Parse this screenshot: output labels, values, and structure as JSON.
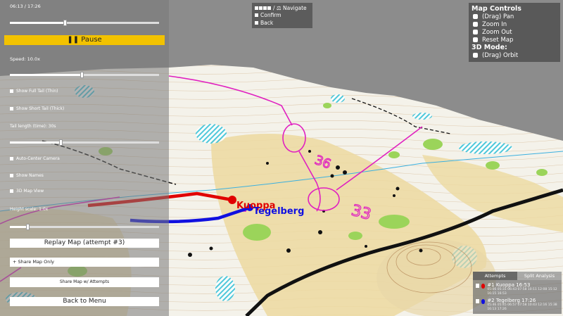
{
  "replay": {
    "time_display": "06:13 / 17:26",
    "progress": 0.37,
    "pause_label": "Pause",
    "speed_label": "Speed: 10.0x",
    "speed_fraction": 0.48
  },
  "options": {
    "show_full_tail": "Show Full Tail (Thin)",
    "show_short_tail": "Show Short Tail (Thick)",
    "tail_length_label": "Tail length (time): 30s",
    "tail_fraction": 0.34,
    "auto_center": "Auto-Center Camera",
    "show_names": "Show Names",
    "map_3d_view": "3D Map View",
    "height_scale_label": "Height scale: 1.0x",
    "height_fraction": 0.12
  },
  "buttons": {
    "replay_map": "Replay Map (attempt #3)",
    "share_map_only": "+ Share Map Only",
    "share_map_attempts": "Share Map w/ Attempts",
    "back_to_menu": "Back to Menu"
  },
  "nav_hint": {
    "navigate": "/ ⚖ Navigate",
    "confirm": "Confirm",
    "back": "Back"
  },
  "map_controls": {
    "title": "Map Controls",
    "pan": "(Drag) Pan",
    "zoom_in": "Zoom In",
    "zoom_out": "Zoom Out",
    "reset": "Reset Map",
    "mode_title": "3D Mode:",
    "orbit": "(Drag) Orbit"
  },
  "runners": [
    {
      "name": "Kuoppa",
      "color": "#e00000"
    },
    {
      "name": "Tegelberg",
      "color": "#1010e0"
    }
  ],
  "map_labels": [
    "36",
    "33"
  ],
  "attempts": {
    "tab_attempts": "Attempts",
    "tab_split": "Split Analysis",
    "rows": [
      {
        "name": "#1 Kuoppa  16:53",
        "color": "#e00000",
        "splits": "05:06 05:31 06:43 07:58 10:11 12:08 15:12 16:15 16:53"
      },
      {
        "name": "#2 Tegelberg  17:26",
        "color": "#1010e0",
        "splits": "05:46 05:45 06:57 07:58 10:43 12:16 15:38 16:13 17:26"
      }
    ]
  },
  "colors": {
    "panel_accent": "#f2c200",
    "runner1": "#e00000",
    "runner2": "#1010e0",
    "course": "#e020c0"
  }
}
